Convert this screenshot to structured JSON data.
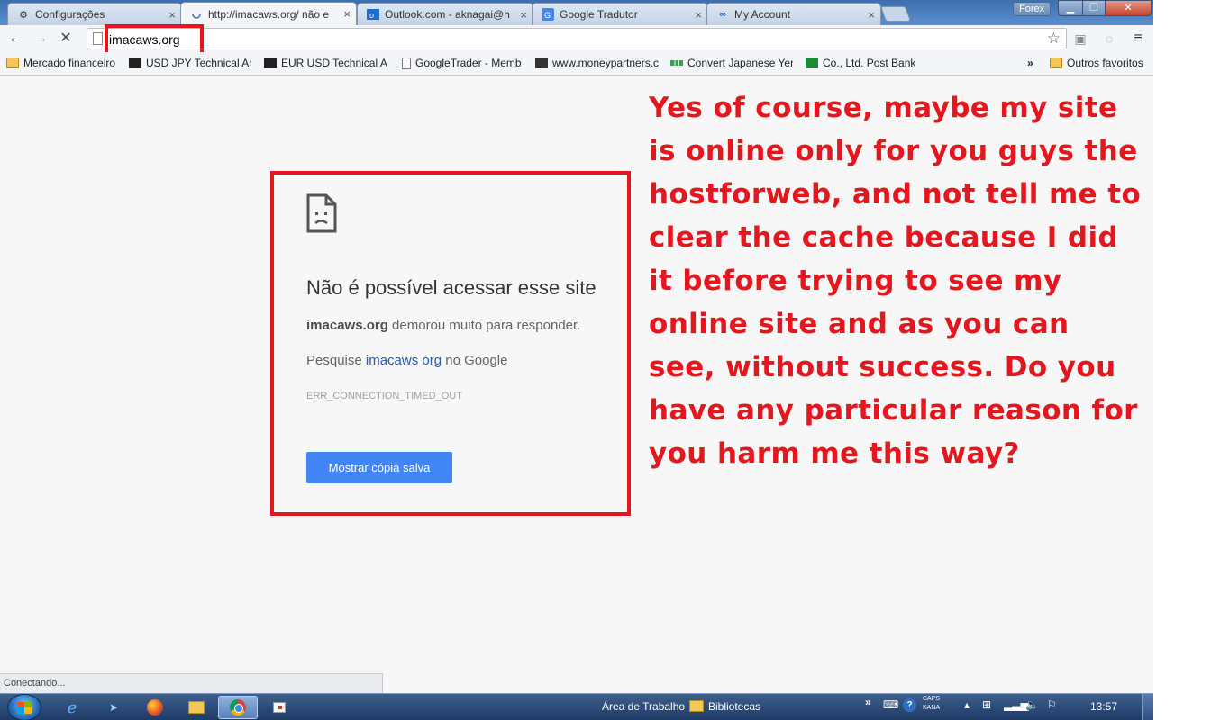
{
  "tabs": [
    {
      "title": "Configurações",
      "icon": "gear-icon",
      "active": false
    },
    {
      "title": "http://imacaws.org/ não e",
      "icon": "loading-spinner-icon",
      "active": true
    },
    {
      "title": "Outlook.com - aknagai@h",
      "icon": "outlook-icon",
      "active": false
    },
    {
      "title": "Google Tradutor",
      "icon": "google-translate-icon",
      "active": false
    },
    {
      "title": "My Account",
      "icon": "infinity-icon",
      "active": false
    }
  ],
  "window": {
    "profile": "Forex"
  },
  "toolbar": {
    "url": "imacaws.org"
  },
  "bookmarks": [
    {
      "label": "Mercado financeiro",
      "icon": "folder-icon"
    },
    {
      "label": "USD JPY Technical An",
      "icon": "investing-icon"
    },
    {
      "label": "EUR USD Technical Ar",
      "icon": "investing-icon"
    },
    {
      "label": "GoogleTrader - Memb",
      "icon": "page-icon"
    },
    {
      "label": "www.moneypartners.c",
      "icon": "moneypartners-icon"
    },
    {
      "label": "Convert Japanese Yen",
      "icon": "green-dots-icon"
    },
    {
      "label": "Co., Ltd. Post Bank",
      "icon": "jp-post-icon"
    }
  ],
  "bookmarks_overflow": "»",
  "other_bookmarks": "Outros favoritos",
  "error": {
    "heading": "Não é possível acessar esse site",
    "site": "imacaws.org",
    "detail": " demorou muito para responder.",
    "search_prefix": "Pesquise ",
    "search_link": "imacaws org",
    "search_suffix": " no Google",
    "code": "ERR_CONNECTION_TIMED_OUT",
    "button": "Mostrar cópia salva"
  },
  "annotation": "Yes of course, maybe my site is online only for you guys the hostforweb, and not tell me to clear the cache because I did it before trying to see my online site and as you can see, without success. Do you have any particular reason for you harm me this way?",
  "status": "Conectando...",
  "taskbar": {
    "desktop_label": "Área de Trabalho",
    "libraries_label": "Bibliotecas",
    "caps": "CAPS",
    "kana": "KANA",
    "clock": "13:57"
  },
  "accent_colors": {
    "annotation_red": "#e4171f",
    "button_blue": "#4285f4",
    "link_blue": "#2a59ae"
  }
}
